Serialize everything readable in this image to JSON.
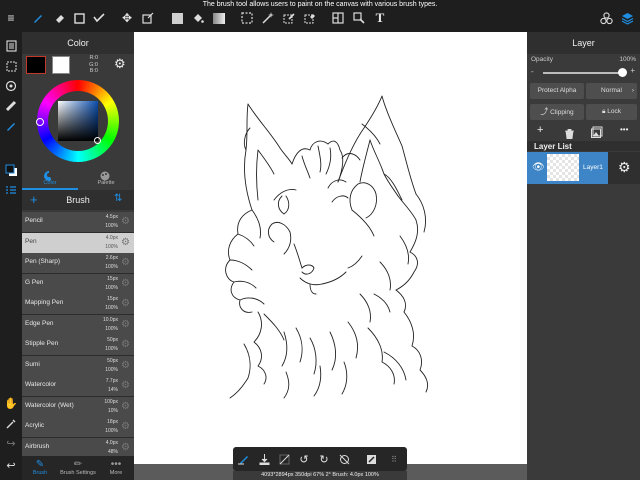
{
  "tooltip": "The brush tool allows users to paint on the canvas with various brush types.",
  "color_panel": {
    "title": "Color",
    "rgb": [
      "R:0",
      "G:0",
      "B:0"
    ],
    "tabs": [
      {
        "label": "Color"
      },
      {
        "label": "Palette"
      }
    ],
    "accent": "#1f8fe3"
  },
  "brush_panel": {
    "title": "Brush",
    "items": [
      {
        "name": "Pencil",
        "size": "4.5px",
        "opacity": "100%",
        "selected": false
      },
      {
        "name": "Pen",
        "size": "4.0px",
        "opacity": "100%",
        "selected": true
      },
      {
        "name": "Pen (Sharp)",
        "size": "2.6px",
        "opacity": "100%",
        "selected": false
      },
      {
        "name": "G Pen",
        "size": "15px",
        "opacity": "100%",
        "selected": false
      },
      {
        "name": "Mapping Pen",
        "size": "15px",
        "opacity": "100%",
        "selected": false
      },
      {
        "name": "Edge Pen",
        "size": "10.0px",
        "opacity": "100%",
        "selected": false
      },
      {
        "name": "Stipple Pen",
        "size": "50px",
        "opacity": "100%",
        "selected": false
      },
      {
        "name": "Sumi",
        "size": "50px",
        "opacity": "100%",
        "selected": false
      },
      {
        "name": "Watercolor",
        "size": "7.7px",
        "opacity": "14%",
        "selected": false
      },
      {
        "name": "Watercolor (Wet)",
        "size": "100px",
        "opacity": "10%",
        "selected": false
      },
      {
        "name": "Acrylic",
        "size": "18px",
        "opacity": "100%",
        "selected": false
      },
      {
        "name": "Airbrush",
        "size": "4.0px",
        "opacity": "48%",
        "selected": false
      }
    ]
  },
  "bottom_tabs": [
    {
      "label": "Brush"
    },
    {
      "label": "Brush Settings"
    },
    {
      "label": "More"
    }
  ],
  "layer_panel": {
    "title": "Layer",
    "opacity_label": "Opacity",
    "opacity_value": "100%",
    "opacity_level": 1.0,
    "minus": "-",
    "plus": "+",
    "protect_alpha": "Protect Alpha",
    "blend_mode": "Normal",
    "clipping": "Clipping",
    "lock": "Lock",
    "list_title": "Layer List",
    "layers": [
      {
        "name": "Layer1"
      }
    ]
  },
  "status_text": "4093*2894px 350dpi 67% 2° Brush: 4.0px 100%"
}
